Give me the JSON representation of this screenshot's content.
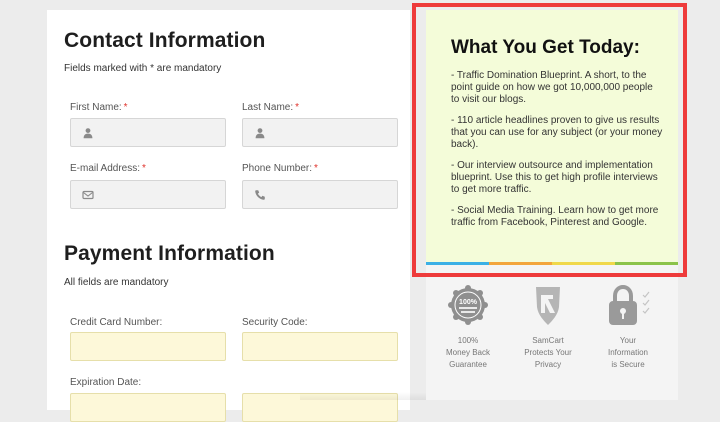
{
  "contact": {
    "title": "Contact Information",
    "note": "Fields marked with * are mandatory",
    "first_name_label": "First Name:",
    "last_name_label": "Last Name:",
    "email_label": "E-mail Address:",
    "phone_label": "Phone Number:",
    "required_mark": "*"
  },
  "payment": {
    "title": "Payment Information",
    "note": "All fields are mandatory",
    "card_label": "Credit Card Number:",
    "security_label": "Security Code:",
    "expiration_label": "Expiration Date:"
  },
  "promo": {
    "title": "What You Get Today:",
    "items": [
      "- Traffic Domination Blueprint. A short, to the point guide on how we got 10,000,000 people to visit our blogs.",
      "- 110 article headlines proven to give us results that you can use for any subject (or your money back).",
      "- Our interview outsource and implementation blueprint. Use this to get high profile interviews to get more traffic.",
      "- Social Media Training. Learn how to get more traffic from Facebook, Pinterest and Google."
    ],
    "stripe_colors": [
      "#3bb0e6",
      "#f3a53c",
      "#f0d84a",
      "#8bc34a"
    ]
  },
  "badges": [
    {
      "icon": "money-back-seal-icon",
      "text": "100%\nMoney Back\nGuarantee",
      "seal_text": "100%"
    },
    {
      "icon": "shield-icon",
      "text": "SamCart\nProtects Your\nPrivacy"
    },
    {
      "icon": "padlock-icon",
      "text": "Your\nInformation\nis Secure"
    }
  ],
  "colors": {
    "highlight_border": "#ee3b3b",
    "promo_background": "#f4fcd9",
    "required": "#e0322b",
    "payment_input_background": "#fdf8d9"
  }
}
